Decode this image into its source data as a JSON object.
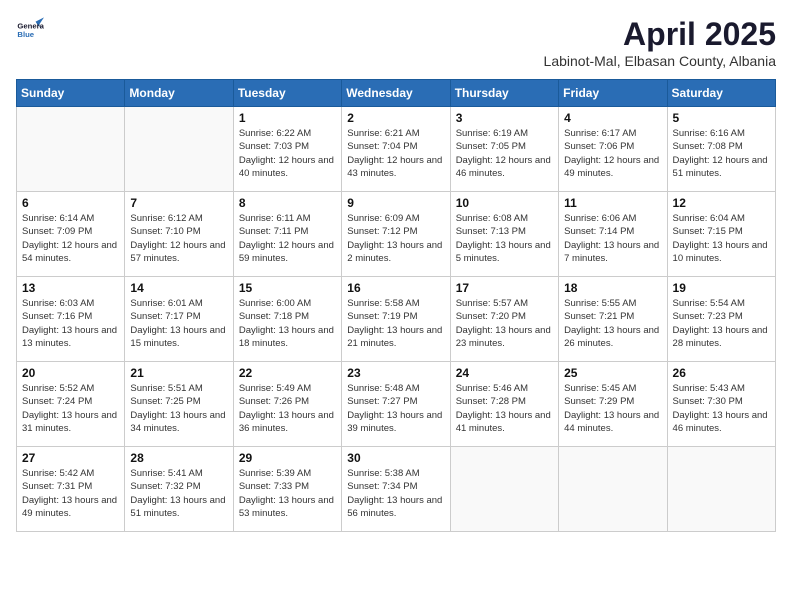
{
  "header": {
    "logo_line1": "General",
    "logo_line2": "Blue",
    "month_year": "April 2025",
    "location": "Labinot-Mal, Elbasan County, Albania"
  },
  "weekdays": [
    "Sunday",
    "Monday",
    "Tuesday",
    "Wednesday",
    "Thursday",
    "Friday",
    "Saturday"
  ],
  "weeks": [
    [
      {
        "day": "",
        "info": ""
      },
      {
        "day": "",
        "info": ""
      },
      {
        "day": "1",
        "info": "Sunrise: 6:22 AM\nSunset: 7:03 PM\nDaylight: 12 hours and 40 minutes."
      },
      {
        "day": "2",
        "info": "Sunrise: 6:21 AM\nSunset: 7:04 PM\nDaylight: 12 hours and 43 minutes."
      },
      {
        "day": "3",
        "info": "Sunrise: 6:19 AM\nSunset: 7:05 PM\nDaylight: 12 hours and 46 minutes."
      },
      {
        "day": "4",
        "info": "Sunrise: 6:17 AM\nSunset: 7:06 PM\nDaylight: 12 hours and 49 minutes."
      },
      {
        "day": "5",
        "info": "Sunrise: 6:16 AM\nSunset: 7:08 PM\nDaylight: 12 hours and 51 minutes."
      }
    ],
    [
      {
        "day": "6",
        "info": "Sunrise: 6:14 AM\nSunset: 7:09 PM\nDaylight: 12 hours and 54 minutes."
      },
      {
        "day": "7",
        "info": "Sunrise: 6:12 AM\nSunset: 7:10 PM\nDaylight: 12 hours and 57 minutes."
      },
      {
        "day": "8",
        "info": "Sunrise: 6:11 AM\nSunset: 7:11 PM\nDaylight: 12 hours and 59 minutes."
      },
      {
        "day": "9",
        "info": "Sunrise: 6:09 AM\nSunset: 7:12 PM\nDaylight: 13 hours and 2 minutes."
      },
      {
        "day": "10",
        "info": "Sunrise: 6:08 AM\nSunset: 7:13 PM\nDaylight: 13 hours and 5 minutes."
      },
      {
        "day": "11",
        "info": "Sunrise: 6:06 AM\nSunset: 7:14 PM\nDaylight: 13 hours and 7 minutes."
      },
      {
        "day": "12",
        "info": "Sunrise: 6:04 AM\nSunset: 7:15 PM\nDaylight: 13 hours and 10 minutes."
      }
    ],
    [
      {
        "day": "13",
        "info": "Sunrise: 6:03 AM\nSunset: 7:16 PM\nDaylight: 13 hours and 13 minutes."
      },
      {
        "day": "14",
        "info": "Sunrise: 6:01 AM\nSunset: 7:17 PM\nDaylight: 13 hours and 15 minutes."
      },
      {
        "day": "15",
        "info": "Sunrise: 6:00 AM\nSunset: 7:18 PM\nDaylight: 13 hours and 18 minutes."
      },
      {
        "day": "16",
        "info": "Sunrise: 5:58 AM\nSunset: 7:19 PM\nDaylight: 13 hours and 21 minutes."
      },
      {
        "day": "17",
        "info": "Sunrise: 5:57 AM\nSunset: 7:20 PM\nDaylight: 13 hours and 23 minutes."
      },
      {
        "day": "18",
        "info": "Sunrise: 5:55 AM\nSunset: 7:21 PM\nDaylight: 13 hours and 26 minutes."
      },
      {
        "day": "19",
        "info": "Sunrise: 5:54 AM\nSunset: 7:23 PM\nDaylight: 13 hours and 28 minutes."
      }
    ],
    [
      {
        "day": "20",
        "info": "Sunrise: 5:52 AM\nSunset: 7:24 PM\nDaylight: 13 hours and 31 minutes."
      },
      {
        "day": "21",
        "info": "Sunrise: 5:51 AM\nSunset: 7:25 PM\nDaylight: 13 hours and 34 minutes."
      },
      {
        "day": "22",
        "info": "Sunrise: 5:49 AM\nSunset: 7:26 PM\nDaylight: 13 hours and 36 minutes."
      },
      {
        "day": "23",
        "info": "Sunrise: 5:48 AM\nSunset: 7:27 PM\nDaylight: 13 hours and 39 minutes."
      },
      {
        "day": "24",
        "info": "Sunrise: 5:46 AM\nSunset: 7:28 PM\nDaylight: 13 hours and 41 minutes."
      },
      {
        "day": "25",
        "info": "Sunrise: 5:45 AM\nSunset: 7:29 PM\nDaylight: 13 hours and 44 minutes."
      },
      {
        "day": "26",
        "info": "Sunrise: 5:43 AM\nSunset: 7:30 PM\nDaylight: 13 hours and 46 minutes."
      }
    ],
    [
      {
        "day": "27",
        "info": "Sunrise: 5:42 AM\nSunset: 7:31 PM\nDaylight: 13 hours and 49 minutes."
      },
      {
        "day": "28",
        "info": "Sunrise: 5:41 AM\nSunset: 7:32 PM\nDaylight: 13 hours and 51 minutes."
      },
      {
        "day": "29",
        "info": "Sunrise: 5:39 AM\nSunset: 7:33 PM\nDaylight: 13 hours and 53 minutes."
      },
      {
        "day": "30",
        "info": "Sunrise: 5:38 AM\nSunset: 7:34 PM\nDaylight: 13 hours and 56 minutes."
      },
      {
        "day": "",
        "info": ""
      },
      {
        "day": "",
        "info": ""
      },
      {
        "day": "",
        "info": ""
      }
    ]
  ]
}
